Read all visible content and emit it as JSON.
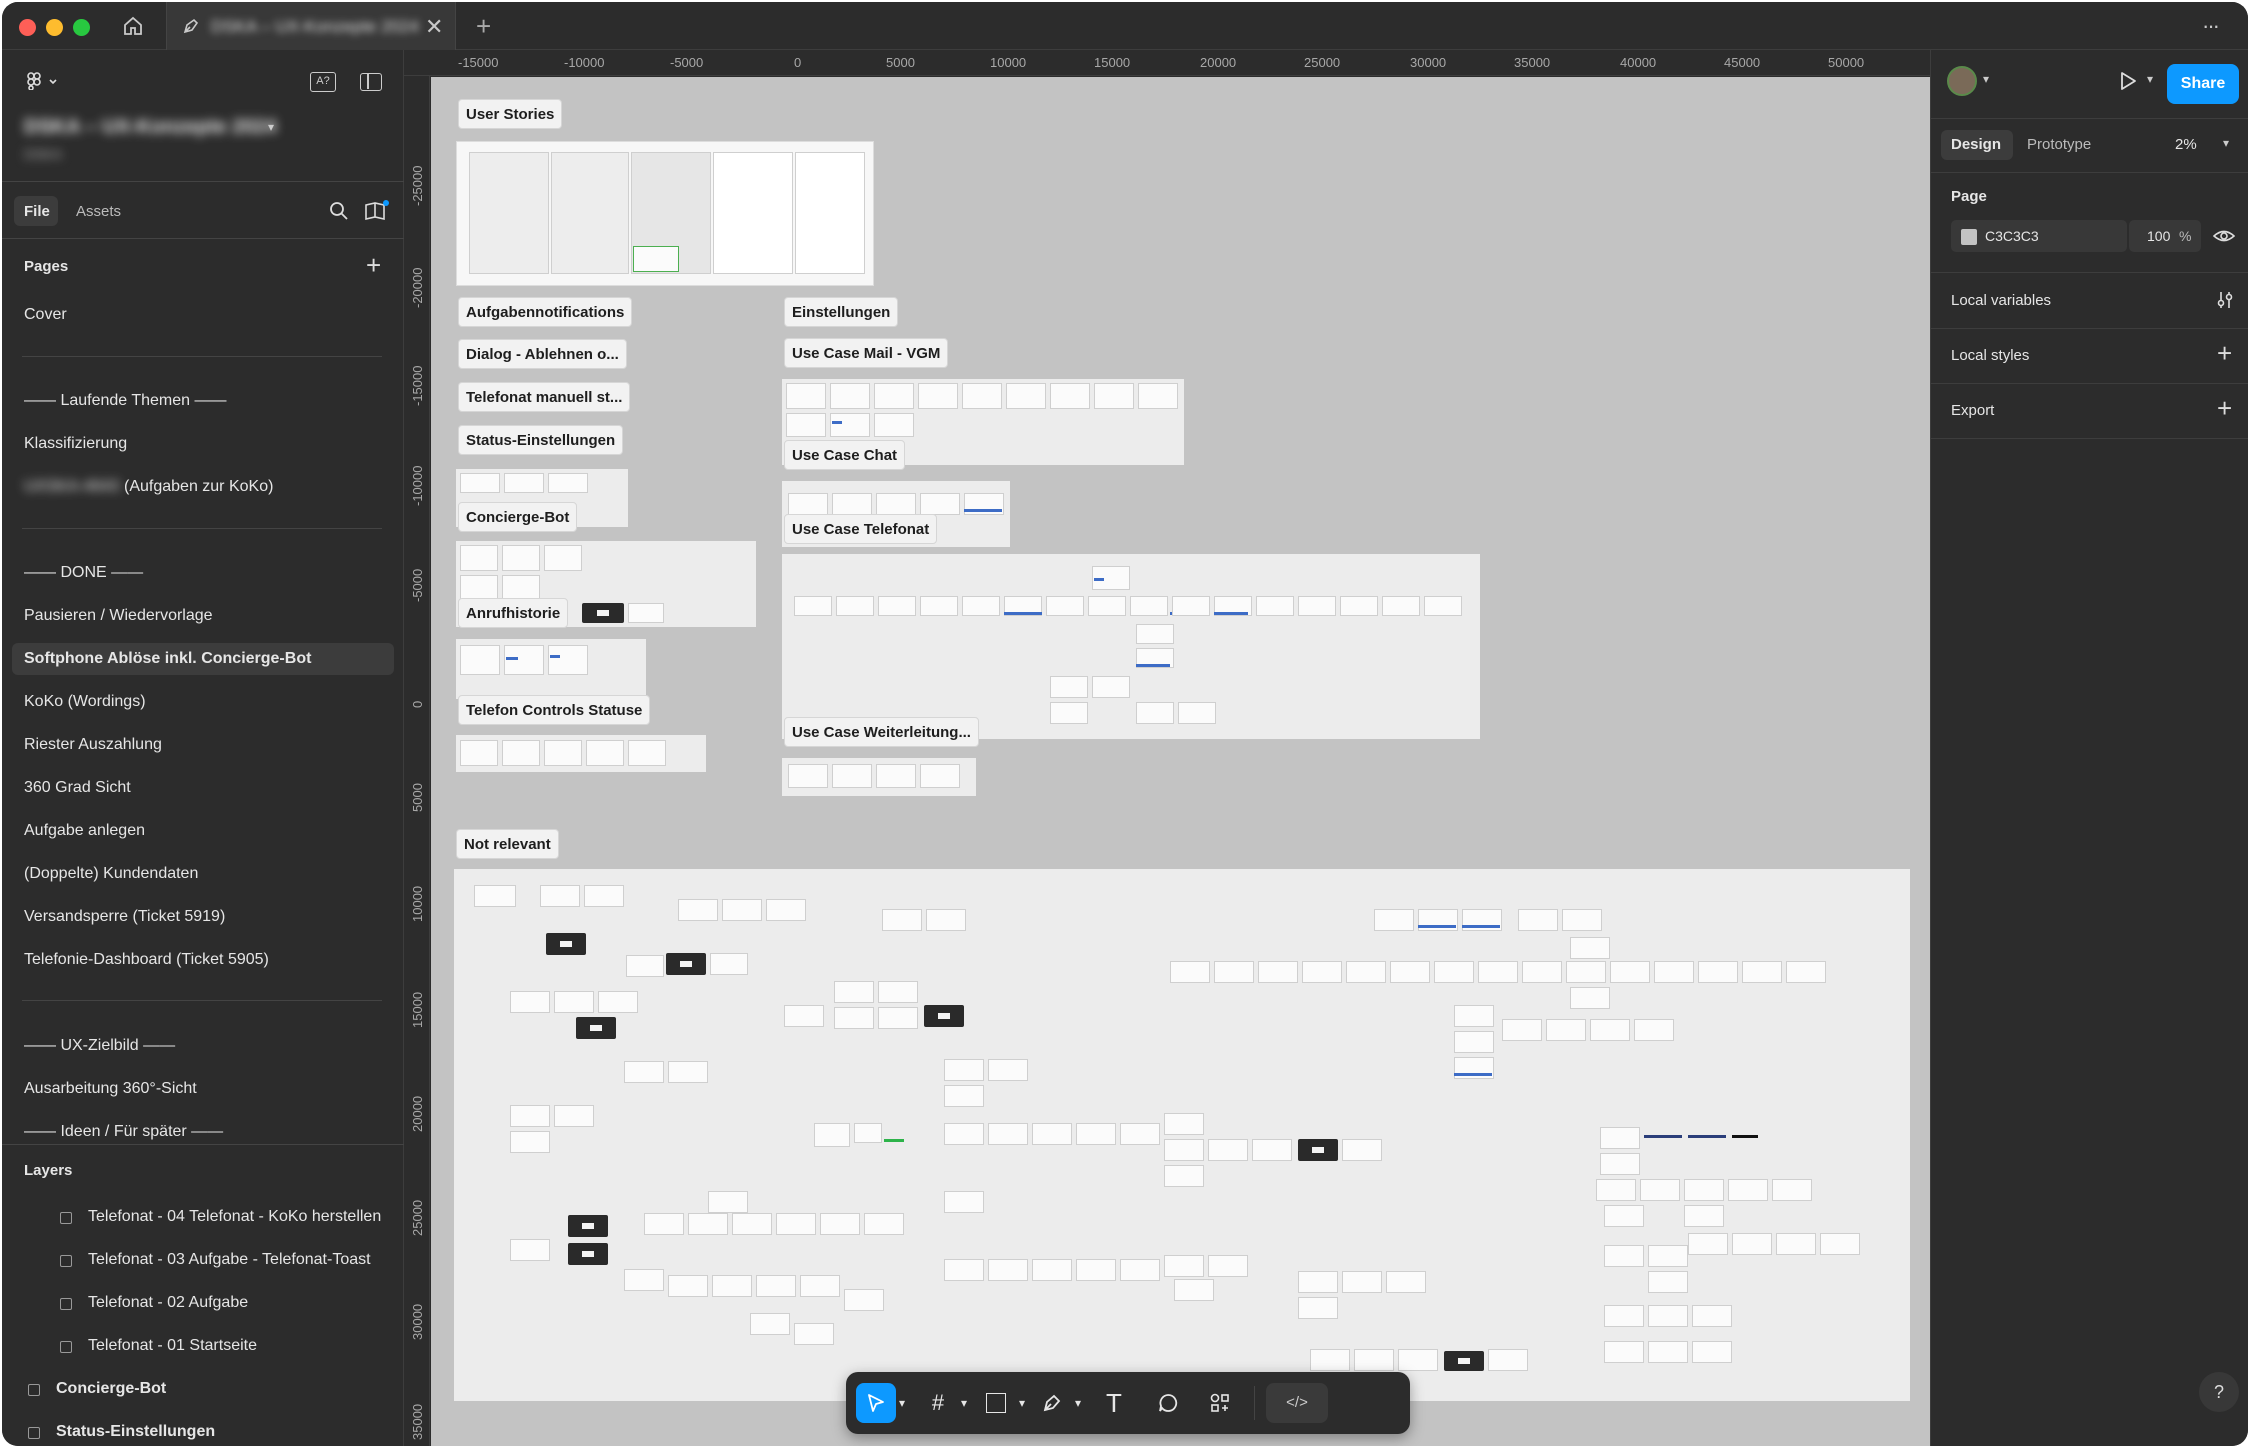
{
  "titlebar": {
    "tab_title": "DSKA – UX-Konzepte 2024",
    "home_icon": "home-icon",
    "new_tab": "+",
    "more": "···"
  },
  "left_panel": {
    "file_name": "DSKA – UX-Konzepte 2024",
    "team_name": "DSKA",
    "tabs": {
      "file": "File",
      "assets": "Assets"
    },
    "pages_heading": "Pages",
    "pages": [
      {
        "label": "Cover"
      },
      {
        "label": "—— Laufende Themen ——"
      },
      {
        "label": "Klassifizierung"
      },
      {
        "label": "(Aufgaben zur KoKo)",
        "blurred_prefix": "UXSKA-4643"
      },
      {
        "label": "—— DONE ——"
      },
      {
        "label": "Pausieren / Wiedervorlage"
      },
      {
        "label": "Softphone Ablöse inkl. Concierge-Bot"
      },
      {
        "label": "KoKo (Wordings)"
      },
      {
        "label": "Riester Auszahlung"
      },
      {
        "label": "360 Grad Sicht"
      },
      {
        "label": "Aufgabe anlegen"
      },
      {
        "label": "(Doppelte) Kundendaten"
      },
      {
        "label": "Versandsperre (Ticket 5919)"
      },
      {
        "label": "Telefonie-Dashboard (Ticket 5905)"
      },
      {
        "label": "—— UX-Zielbild ——"
      },
      {
        "label": "Ausarbeitung 360°-Sicht"
      },
      {
        "label": "—— Ideen / Für später ——"
      }
    ],
    "layers_heading": "Layers",
    "layers": [
      {
        "label": "Telefonat - 04 Telefonat - KoKo herstellen"
      },
      {
        "label": "Telefonat - 03 Aufgabe - Telefonat-Toast"
      },
      {
        "label": "Telefonat - 02 Aufgabe"
      },
      {
        "label": "Telefonat - 01 Startseite"
      },
      {
        "label": "Concierge-Bot"
      },
      {
        "label": "Status-Einstellungen"
      }
    ]
  },
  "rulers": {
    "horizontal": [
      "-15000",
      "-10000",
      "-5000",
      "0",
      "5000",
      "10000",
      "15000",
      "20000",
      "25000",
      "30000",
      "35000",
      "40000",
      "45000",
      "50000"
    ],
    "vertical": [
      "-25000",
      "-20000",
      "-15000",
      "-10000",
      "-5000",
      "0",
      "5000",
      "10000",
      "15000",
      "20000",
      "25000",
      "30000",
      "35000"
    ]
  },
  "canvas": {
    "labels": {
      "user_stories": "User Stories",
      "aufgabennotifications": "Aufgabennotifications",
      "dialog": "Dialog - Ablehnen o...",
      "telefonat_manuell": "Telefonat manuell st...",
      "status_einstellungen": "Status-Einstellungen",
      "concierge_bot": "Concierge-Bot",
      "anrufhistorie": "Anrufhistorie",
      "telefon_controls": "Telefon Controls Statuse",
      "einstellungen": "Einstellungen",
      "use_case_mail": "Use Case Mail - VGM",
      "use_case_chat": "Use Case Chat",
      "use_case_telefonat": "Use Case Telefonat",
      "use_case_weiterleitung": "Use Case Weiterleitung...",
      "not_relevant": "Not relevant"
    }
  },
  "right_panel": {
    "tabs": {
      "design": "Design",
      "prototype": "Prototype"
    },
    "zoom": "2%",
    "share_label": "Share",
    "page_heading": "Page",
    "page_color": "C3C3C3",
    "page_opacity": "100",
    "percent": "%",
    "local_variables": "Local variables",
    "local_styles": "Local styles",
    "export": "Export",
    "help": "?"
  },
  "colors": {
    "accent": "#0d99ff",
    "panel": "#2c2c2c",
    "canvas": "#c3c3c3"
  }
}
